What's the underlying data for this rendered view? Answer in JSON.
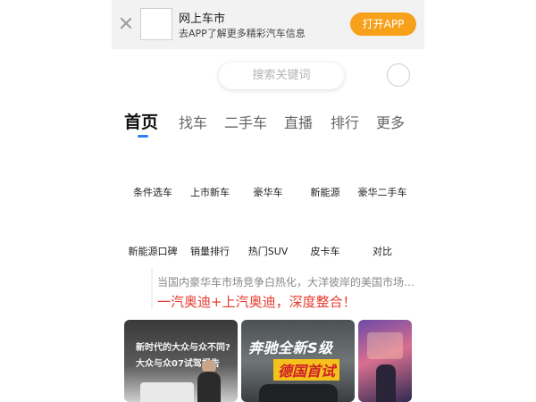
{
  "banner": {
    "title": "网上车市",
    "subtitle": "去APP了解更多精彩汽车信息",
    "open_app_label": "打开APP"
  },
  "search": {
    "placeholder": "搜索关键词"
  },
  "tabs": [
    {
      "label": "首页",
      "active": true
    },
    {
      "label": "找车"
    },
    {
      "label": "二手车"
    },
    {
      "label": "直播"
    },
    {
      "label": "排行"
    },
    {
      "label": "更多"
    }
  ],
  "nav_row1": [
    "条件选车",
    "上市新车",
    "豪华车",
    "新能源",
    "豪华二手车"
  ],
  "nav_row2": [
    "新能源口碑",
    "销量排行",
    "热门SUV",
    "皮卡车",
    "对比"
  ],
  "news": {
    "summary": "当国内豪华车市场竞争白热化，大洋彼岸的美国市场，…",
    "headline": "一汽奥迪+上汽奥迪，深度整合！"
  },
  "cards": {
    "card1_line1": "新时代的大众与众不同?",
    "card1_line2": "大众与众07试驾报告",
    "card2_line1": "奔驰全新S级",
    "card2_line2": "德国首试"
  },
  "colors": {
    "accent_orange": "#f7a01a",
    "tab_underline": "#2f7ff5",
    "headline_red": "#e53a2f"
  }
}
